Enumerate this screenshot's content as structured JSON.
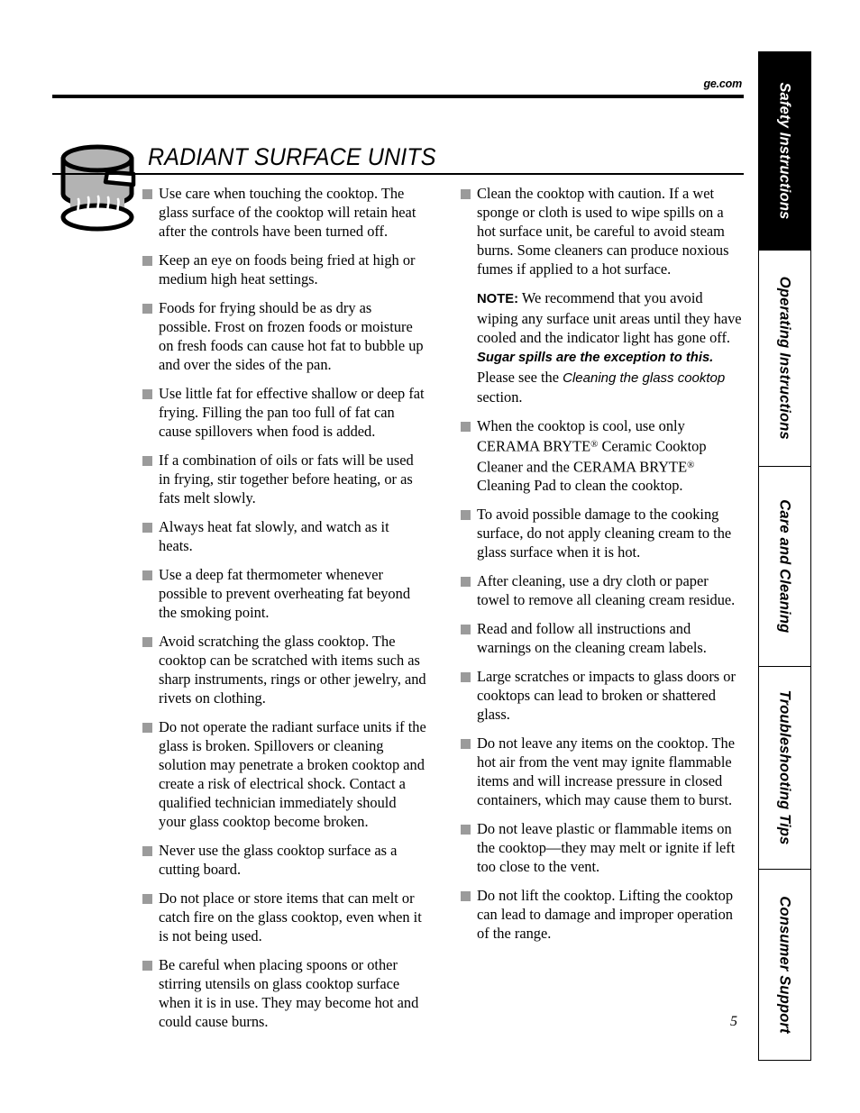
{
  "header": {
    "site_url": "ge.com"
  },
  "section": {
    "title": "RADIANT SURFACE UNITS",
    "illustration_name": "cooktop-pot-heating-element"
  },
  "page_number": "5",
  "colors": {
    "bullet_gray": "#9b9b9b",
    "active_tab_bg": "#000000",
    "active_tab_text": "#ffffff",
    "rule": "#000000"
  },
  "side_tabs": [
    {
      "label": "Safety Instructions",
      "active": true
    },
    {
      "label": "Operating Instructions",
      "active": false
    },
    {
      "label": "Care and Cleaning",
      "active": false
    },
    {
      "label": "Troubleshooting Tips",
      "active": false
    },
    {
      "label": "Consumer Support",
      "active": false
    }
  ],
  "left_column": [
    {
      "type": "bullet",
      "text": "Use care when touching the cooktop. The glass surface of the cooktop will retain heat after the controls have been turned off."
    },
    {
      "type": "bullet",
      "text": "Keep an eye on foods being fried at high or medium high heat settings."
    },
    {
      "type": "bullet",
      "text": "Foods for frying should be as dry as possible. Frost on frozen foods or moisture on fresh foods can cause hot fat to bubble up and over the sides of the pan."
    },
    {
      "type": "bullet",
      "text": "Use little fat for effective shallow or deep fat frying. Filling the pan too full of fat can cause spillovers when food is added."
    },
    {
      "type": "bullet",
      "text": "If a combination of oils or fats will be used in frying, stir together before heating, or as fats melt slowly."
    },
    {
      "type": "bullet",
      "text": "Always heat fat slowly, and watch as it heats."
    },
    {
      "type": "bullet",
      "text": "Use a deep fat thermometer whenever possible to prevent overheating fat beyond the smoking point."
    },
    {
      "type": "bullet",
      "text": "Avoid scratching the glass cooktop. The cooktop can be scratched with items such as sharp instruments, rings or other jewelry, and rivets on clothing."
    },
    {
      "type": "bullet",
      "text": "Do not operate the radiant surface units if the glass is broken. Spillovers or cleaning solution may penetrate a broken cooktop and create a risk of electrical shock. Contact a qualified technician immediately should your glass cooktop become broken."
    },
    {
      "type": "bullet",
      "text": "Never use the glass cooktop surface as a cutting board."
    },
    {
      "type": "bullet",
      "text": "Do not place or store items that can melt or catch fire on the glass cooktop, even when it is not being used."
    },
    {
      "type": "bullet",
      "text": "Be careful when placing spoons or other stirring utensils on glass cooktop surface when it is in use. They may become hot and could cause burns."
    }
  ],
  "right_column": [
    {
      "type": "bullet",
      "text": "Clean the cooktop with caution. If a wet sponge or cloth is used to wipe spills on a hot surface unit, be careful to avoid steam burns. Some cleaners can produce noxious fumes if applied to a hot surface."
    },
    {
      "type": "note",
      "note_label": "NOTE:",
      "part1": " We recommend that you avoid wiping any surface unit areas until they have cooled and the indicator light has gone off. ",
      "emphasis": "Sugar spills are the exception to this.",
      "part2": " Please see the ",
      "reference": "Cleaning the glass cooktop",
      "part3": " section."
    },
    {
      "type": "bullet_trademark",
      "text_before": "When the cooktop is cool, use only CERAMA BRYTE",
      "text_middle": " Ceramic Cooktop Cleaner and the CERAMA BRYTE",
      "text_after": " Cleaning Pad to clean the cooktop.",
      "trademark_symbol": "®"
    },
    {
      "type": "bullet",
      "text": "To avoid possible damage to the cooking surface, do not apply cleaning cream to the glass surface when it is hot."
    },
    {
      "type": "bullet",
      "text": "After cleaning, use a dry cloth or paper towel to remove all cleaning cream residue."
    },
    {
      "type": "bullet",
      "text": "Read and follow all instructions and warnings on the cleaning cream labels."
    },
    {
      "type": "bullet",
      "text": "Large scratches or impacts to glass doors or cooktops can lead to broken or shattered glass."
    },
    {
      "type": "bullet",
      "text": "Do not leave any items on the cooktop. The hot air from the vent may ignite flammable items and will increase pressure in closed containers, which may cause them to burst."
    },
    {
      "type": "bullet",
      "text": "Do not leave plastic or flammable items on the cooktop—they may melt or ignite if left too close to the vent."
    },
    {
      "type": "bullet",
      "text": "Do not lift the cooktop. Lifting the cooktop can lead to damage and improper operation of the range."
    }
  ]
}
